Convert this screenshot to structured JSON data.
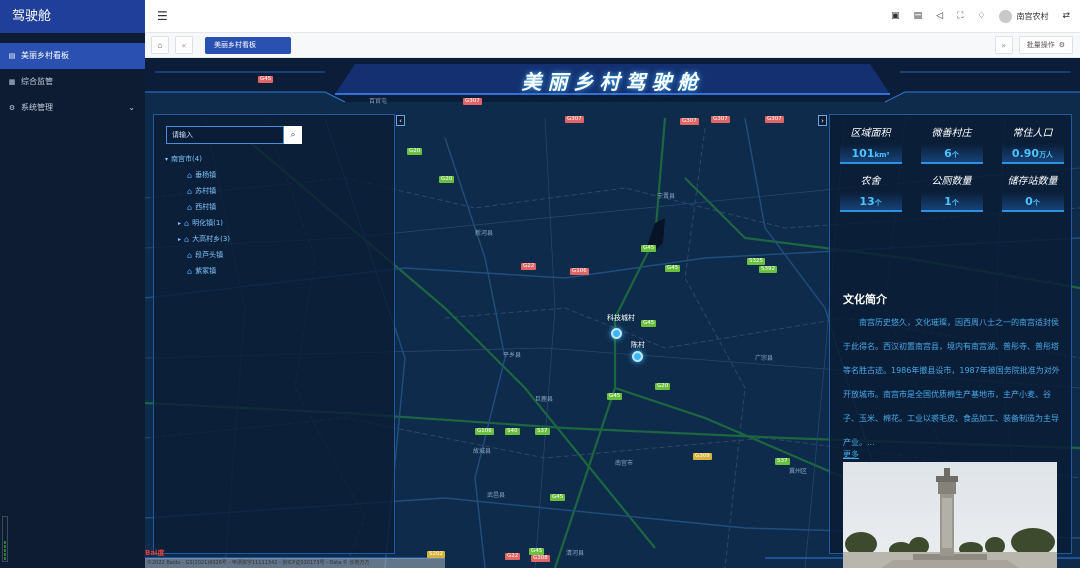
{
  "app": {
    "brand": "驾驶舱"
  },
  "sidebar": {
    "items": [
      {
        "label": "美丽乡村看板",
        "icon": "dashboard-icon"
      },
      {
        "label": "综合监管",
        "icon": "grid-icon"
      },
      {
        "label": "系统管理",
        "icon": "gear-icon"
      }
    ]
  },
  "topbar": {
    "user_name": "南宫农村"
  },
  "tabs": {
    "active_label": "美丽乡村看板",
    "batch_label": "批量操作"
  },
  "dashboard": {
    "title": "美丽乡村驾驶舱",
    "search": {
      "placeholder": "请输入"
    },
    "tree": {
      "root": "南宫市(4)",
      "children": [
        {
          "label": "垂杨镇",
          "expandable": false
        },
        {
          "label": "苏村镇",
          "expandable": false
        },
        {
          "label": "西村镇",
          "expandable": false
        },
        {
          "label": "明化镇(1)",
          "expandable": true
        },
        {
          "label": "大高村乡(3)",
          "expandable": true
        },
        {
          "label": "段芦头镇",
          "expandable": false
        },
        {
          "label": "紫冢镇",
          "expandable": false
        }
      ]
    },
    "stats": [
      {
        "label": "区域面积",
        "value": "101",
        "unit": "km²"
      },
      {
        "label": "微善村庄",
        "value": "6",
        "unit": "个"
      },
      {
        "label": "常住人口",
        "value": "0.90",
        "unit": "万人"
      },
      {
        "label": "农舍",
        "value": "13",
        "unit": "个"
      },
      {
        "label": "公厕数量",
        "value": "1",
        "unit": "个"
      },
      {
        "label": "储存站数量",
        "value": "0",
        "unit": "个"
      }
    ],
    "culture": {
      "title": "文化简介",
      "text": "南宫历史悠久，文化璀璨，因西周八士之一的南宫适封侯于此得名。西汉初置南宫县，境内有南宫湖、普彤寺、普彤塔等名胜古迹。1986年撤县设市，1987年被国务院批准为对外开放城市。南宫市是全国优质棉生产基地市，主产小麦、谷子、玉米、棉花。工业以裘毛皮、食品加工、装备制造为主导产业。...",
      "more": "更多"
    },
    "map": {
      "pins": [
        {
          "label": "科技城村"
        },
        {
          "label": "陈村"
        }
      ],
      "road_labels": [
        "G45",
        "G20",
        "G307",
        "S392",
        "G106",
        "S40",
        "S37",
        "G309",
        "G22",
        "S325",
        "G308",
        "S202"
      ],
      "towns": [
        "百官屯",
        "南宫市",
        "威县",
        "新河县",
        "冀州区",
        "清河县",
        "巨鹿县",
        "故城县",
        "枣强县",
        "临西县",
        "景县",
        "武邑县",
        "衡水市",
        "宁晋县",
        "平乡县",
        "广宗县"
      ],
      "attribution": "©2022 Baidu - GS(2021)6026号 - 甲测资字11111342 - 京ICP证030173号 - Data © 长地万方"
    }
  }
}
